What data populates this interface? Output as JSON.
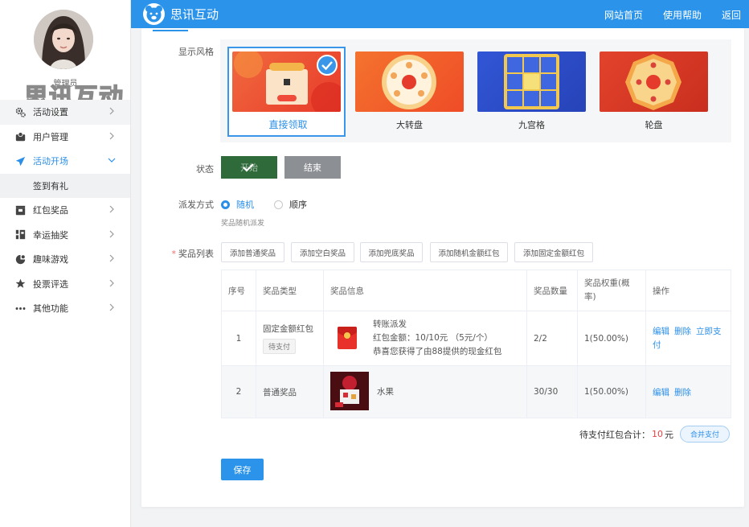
{
  "brand": {
    "watermark": "思讯互动",
    "title": "思讯互动"
  },
  "topnav": {
    "home": "网站首页",
    "help": "使用帮助",
    "back": "返回"
  },
  "user": {
    "name": "管理员"
  },
  "sidebar": {
    "items": [
      {
        "label": "活动设置",
        "icon": "gears-icon"
      },
      {
        "label": "用户管理",
        "icon": "user-box-icon"
      },
      {
        "label": "活动开场",
        "icon": "paper-plane-icon"
      },
      {
        "label": "红包奖品",
        "icon": "gift-box-icon"
      },
      {
        "label": "幸运抽奖",
        "icon": "sliders-icon"
      },
      {
        "label": "趣味游戏",
        "icon": "game-icon"
      },
      {
        "label": "投票评选",
        "icon": "star-icon"
      },
      {
        "label": "其他功能",
        "icon": "more-dots-icon"
      }
    ],
    "sub_item": "签到有礼"
  },
  "form": {
    "style_label": "显示风格",
    "styles": [
      {
        "label": "直接领取",
        "selected": true
      },
      {
        "label": "大转盘",
        "selected": false
      },
      {
        "label": "九宫格",
        "selected": false
      },
      {
        "label": "轮盘",
        "selected": false
      }
    ],
    "status_label": "状态",
    "status_start": "开始",
    "status_end": "结束",
    "dispatch_label": "派发方式",
    "dispatch_random": "随机",
    "dispatch_sequential": "顺序",
    "dispatch_hint": "奖品随机派发",
    "required_mark": "*",
    "prizes_label": "奖品列表",
    "add_buttons": [
      "添加普通奖品",
      "添加空白奖品",
      "添加兜底奖品",
      "添加随机金额红包",
      "添加固定金额红包"
    ]
  },
  "table": {
    "headers": [
      "序号",
      "奖品类型",
      "奖品信息",
      "奖品数量",
      "奖品权重(概率)",
      "操作"
    ],
    "rows": [
      {
        "index": "1",
        "type": "固定金额红包",
        "tag": "待支付",
        "info_lines": [
          "转账派发",
          "红包金额：10/10元 （5元/个）",
          "恭喜您获得了由88提供的现金红包"
        ],
        "quantity": "2/2",
        "weight": "1(50.00%)",
        "actions": [
          "编辑",
          "删除",
          "立即支付"
        ]
      },
      {
        "index": "2",
        "type": "普通奖品",
        "info_lines": [
          "水果"
        ],
        "quantity": "30/30",
        "weight": "1(50.00%)",
        "actions": [
          "编辑",
          "删除"
        ]
      }
    ]
  },
  "summary": {
    "label": "待支付红包合计：",
    "amount": "10",
    "unit": "元",
    "merge_button": "合并支付"
  },
  "save_button": "保存",
  "colors": {
    "primary": "#2b94ea",
    "start_button": "#2f6b3a",
    "end_button": "#8c8f94",
    "amount_red": "#e64340"
  }
}
